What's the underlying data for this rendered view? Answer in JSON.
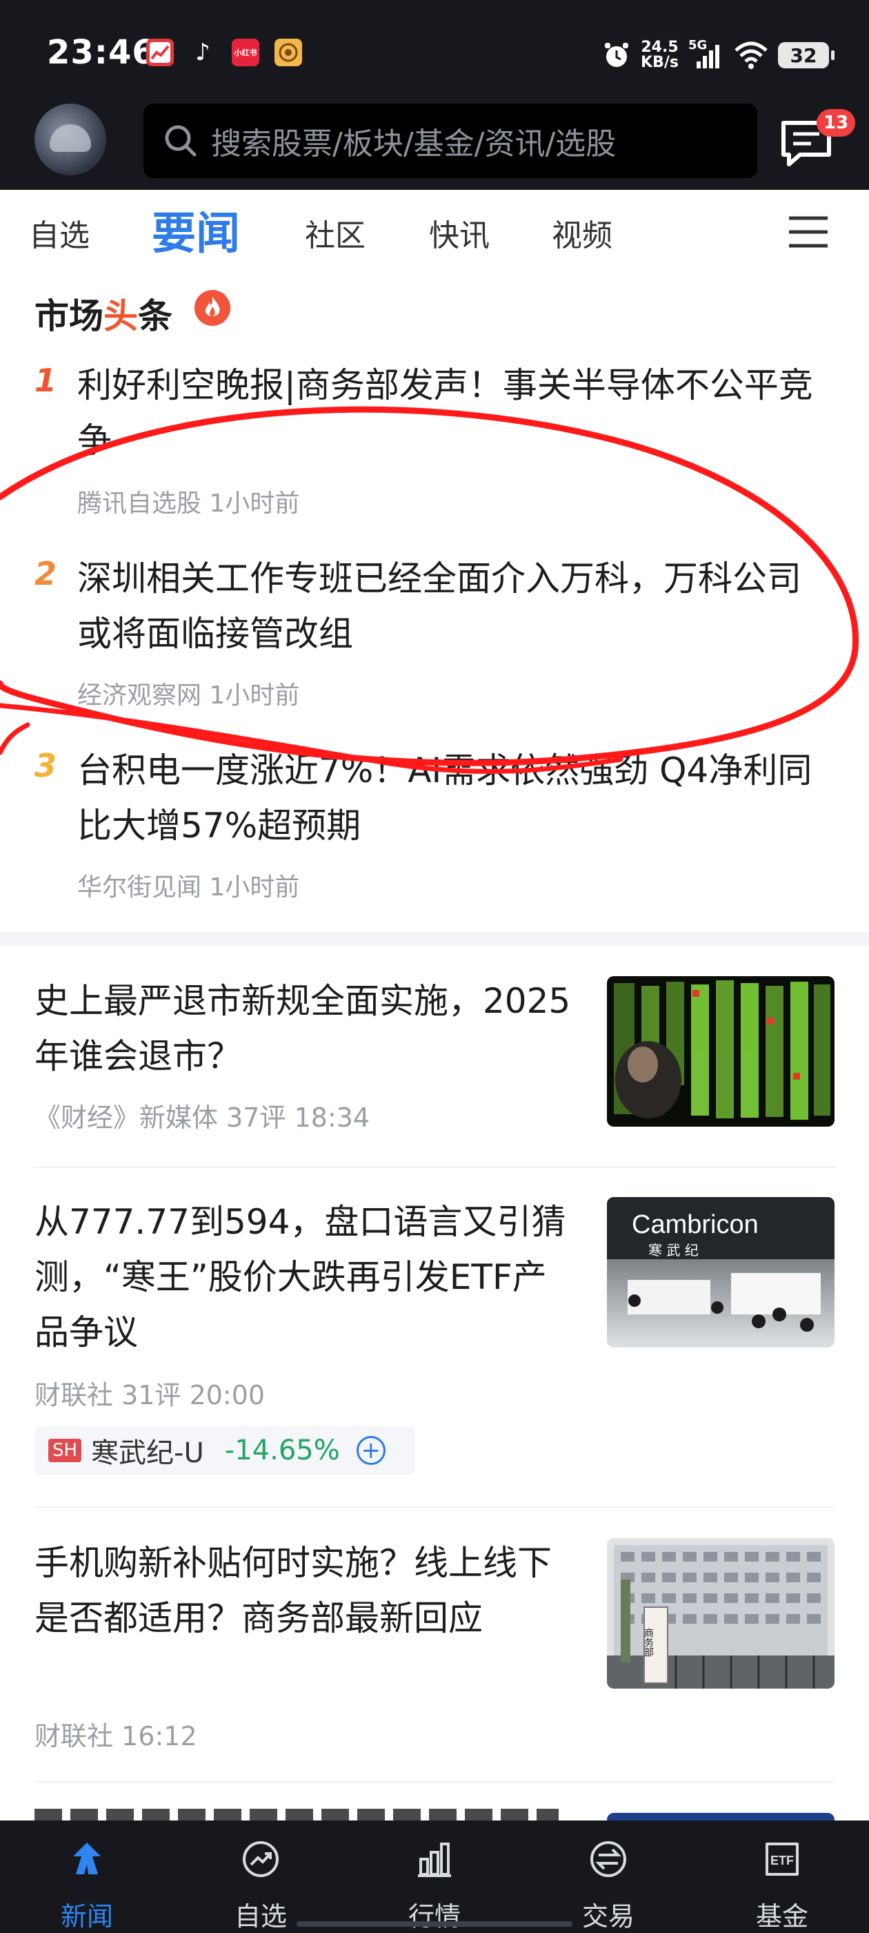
{
  "status_bar": {
    "time": "23:46",
    "apps": [
      "stock-app-icon",
      "tiktok-icon",
      "xiaohongshu-icon",
      "coin-app-icon"
    ],
    "xiaohongshu_text": "小红书",
    "net_speed_value": "24.5",
    "net_speed_unit": "KB/s",
    "network": "5G",
    "battery": "32"
  },
  "header": {
    "search_placeholder": "搜索股票/板块/基金/资讯/选股",
    "message_badge": "13"
  },
  "tabs": [
    {
      "label": "自选",
      "active": false
    },
    {
      "label": "要闻",
      "active": true
    },
    {
      "label": "社区",
      "active": false
    },
    {
      "label": "快讯",
      "active": false
    },
    {
      "label": "视频",
      "active": false
    }
  ],
  "headlines": {
    "title_part1": "市场",
    "title_accent": "头",
    "title_part2": "条",
    "items": [
      {
        "rank": "1",
        "rank_color": "#f0552f",
        "text": "利好利空晚报|商务部发声！事关半导体不公平竞争",
        "source": "腾讯自选股",
        "time": "1小时前"
      },
      {
        "rank": "2",
        "rank_color": "#f28a37",
        "text": "深圳相关工作专班已经全面介入万科，万科公司或将面临接管改组",
        "source": "经济观察网",
        "time": "1小时前"
      },
      {
        "rank": "3",
        "rank_color": "#f4b133",
        "text": "台积电一度涨近7%！AI需求依然强劲 Q4净利同比大增57%超预期",
        "source": "华尔街见闻",
        "time": "1小时前"
      }
    ]
  },
  "feed": [
    {
      "title": "史上最严退市新规全面实施，2025年谁会退市？",
      "source": "《财经》新媒体",
      "comments": "37评",
      "time": "18:34"
    },
    {
      "title": "从777.77到594，盘口语言又引猜测，“寒王”股价大跌再引发ETF产品争议",
      "source": "财联社",
      "comments": "31评",
      "time": "20:00",
      "stock": {
        "market": "SH",
        "name": "寒武纪-U",
        "change": "-14.65%"
      }
    },
    {
      "title": "手机购新补贴何时实施？线上线下是否都适用？商务部最新回应",
      "source": "财联社",
      "comments": "",
      "time": "16:12"
    }
  ],
  "thumb_texts": {
    "cambricon": "Cambricon",
    "cambricon_cn": "寒 武 纪",
    "mofcom_sign": "商务部"
  },
  "bottom_nav": [
    {
      "label": "新闻",
      "icon": "news-icon",
      "active": true
    },
    {
      "label": "自选",
      "icon": "watchlist-icon",
      "active": false
    },
    {
      "label": "行情",
      "icon": "market-icon",
      "active": false
    },
    {
      "label": "交易",
      "icon": "trade-icon",
      "active": false
    },
    {
      "label": "基金",
      "icon": "fund-icon",
      "active": false
    }
  ],
  "colors": {
    "accent_blue": "#2f7be8",
    "rise_red": "#e24b50",
    "fall_green": "#22a463",
    "annotation_red": "#ff1a1a"
  }
}
